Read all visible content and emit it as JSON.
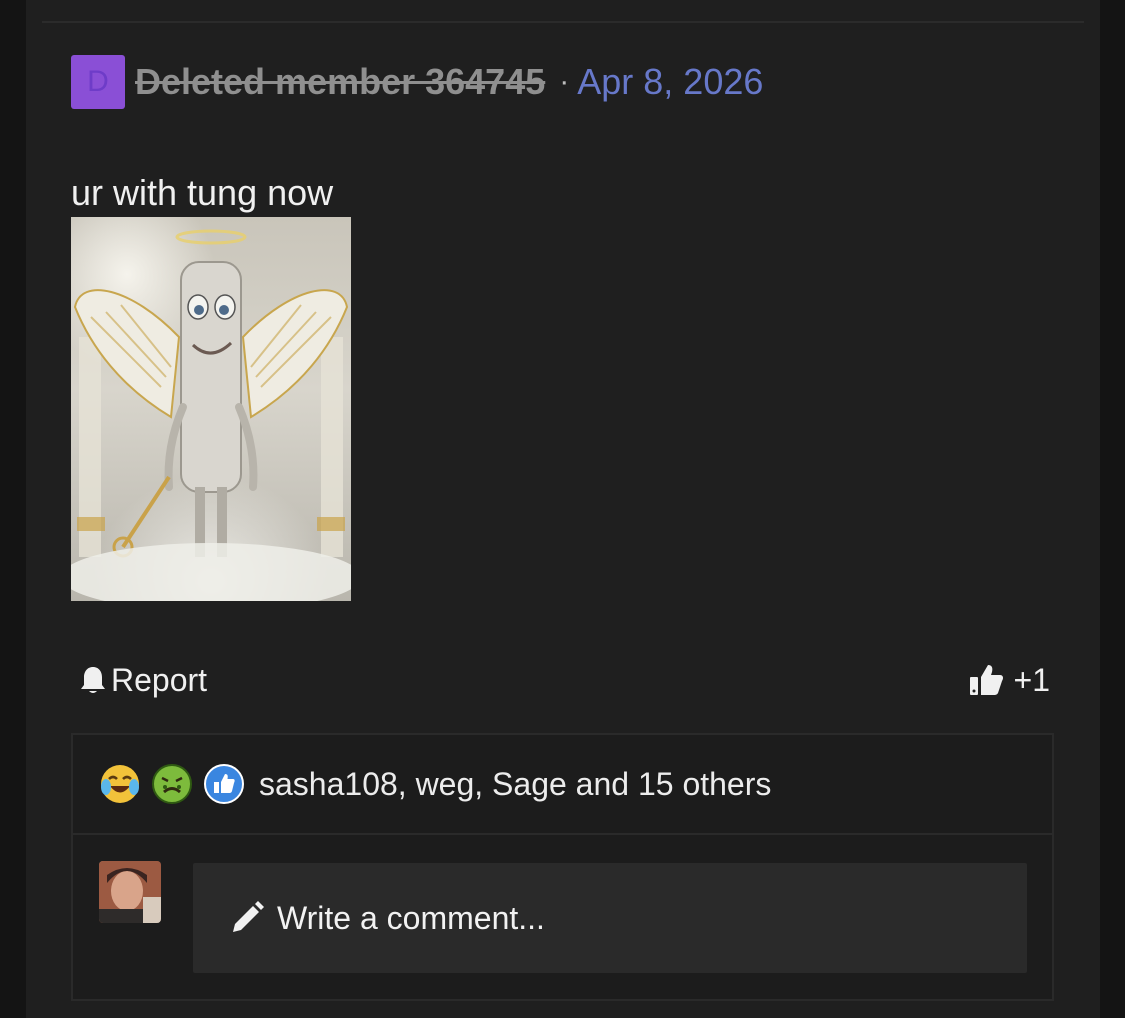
{
  "post": {
    "author": {
      "avatar_letter": "D",
      "name": "Deleted member 364745"
    },
    "separator": "·",
    "date": "Apr 8, 2026",
    "text": "ur with tung now",
    "image_alt": "Angelic smiling figure with wings in clouds"
  },
  "actions": {
    "report_label": "Report",
    "like_count": "+1"
  },
  "reactions": {
    "emojis": [
      "laughing-crying-icon",
      "nauseated-face-icon",
      "thumbs-up-badge-icon"
    ],
    "summary": "sasha108, weg, Sage and 15 others"
  },
  "comment": {
    "placeholder": "Write a comment..."
  },
  "colors": {
    "avatar_bg": "#8a4fd6",
    "date": "#6778c9",
    "panel": "#1f1f1f"
  }
}
